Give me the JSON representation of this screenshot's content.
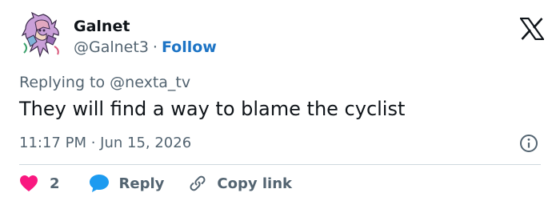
{
  "author": {
    "name": "Galnet",
    "handle": "@Galnet3",
    "separator": "·",
    "follow_label": "Follow"
  },
  "reply_context": {
    "prefix": "Replying to",
    "mention": "@nexta_tv"
  },
  "tweet": {
    "text": "They will find a way to blame the cyclist",
    "timestamp": "11:17 PM · Jun 15, 2026"
  },
  "actions": {
    "like_count": "2",
    "reply_label": "Reply",
    "copy_link_label": "Copy link"
  },
  "colors": {
    "like": "#f91880",
    "reply": "#1d9bf0",
    "follow": "#1d74c5",
    "muted": "#536471",
    "text": "#0f1419",
    "divider": "#cfd9de"
  },
  "icons": {
    "avatar": "anime-character-avatar",
    "logo": "x-logo-icon",
    "info": "info-icon",
    "like": "heart-icon",
    "reply": "speech-bubble-icon",
    "copy_link": "link-icon"
  }
}
